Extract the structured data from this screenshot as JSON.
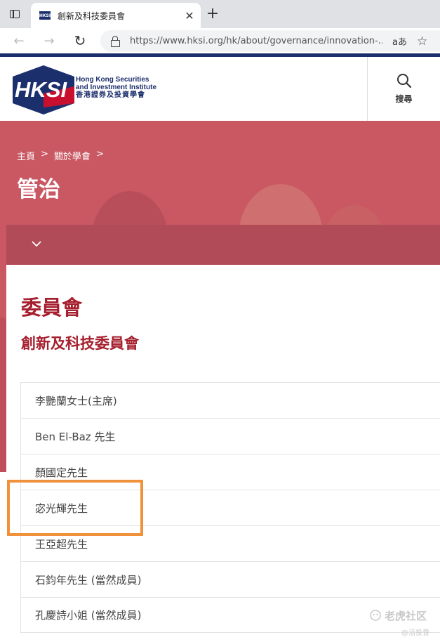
{
  "browser": {
    "tab_title": "創新及科技委員會",
    "tab_close": "✕",
    "new_tab": "+",
    "url": "https://www.hksi.org/hk/about/governance/innovation-...",
    "read_aloud": "aあ",
    "favicon_text": "HKSI"
  },
  "site": {
    "logo": {
      "mark_text": "HKSI",
      "name_en_line1": "Hong Kong Securities",
      "name_en_line2": "and Investment Institute",
      "name_zh": "香港證券及投資學會"
    },
    "search_label": "搜尋"
  },
  "hero": {
    "breadcrumb": [
      {
        "label": "主頁"
      },
      {
        "label": "關於學會"
      }
    ],
    "breadcrumb_sep": ">",
    "title": "管治"
  },
  "content": {
    "section_title": "委員會",
    "committee_title": "創新及科技委員會",
    "members": [
      "李艷蘭女士(主席)",
      "Ben El-Baz 先生",
      "顏國定先生",
      "宓光輝先生",
      "王亞超先生",
      "石鈞年先生 (當然成員)",
      "孔慶詩小姐 (當然成員)"
    ]
  },
  "watermark": {
    "main": "老虎社区",
    "sub": "@活投昏"
  },
  "colors": {
    "brand_navy": "#1c2f6d",
    "brand_red": "#a61f2e",
    "hero_pink": "#cf6a74",
    "subbar": "#b24b58",
    "highlight": "#f0923b"
  }
}
